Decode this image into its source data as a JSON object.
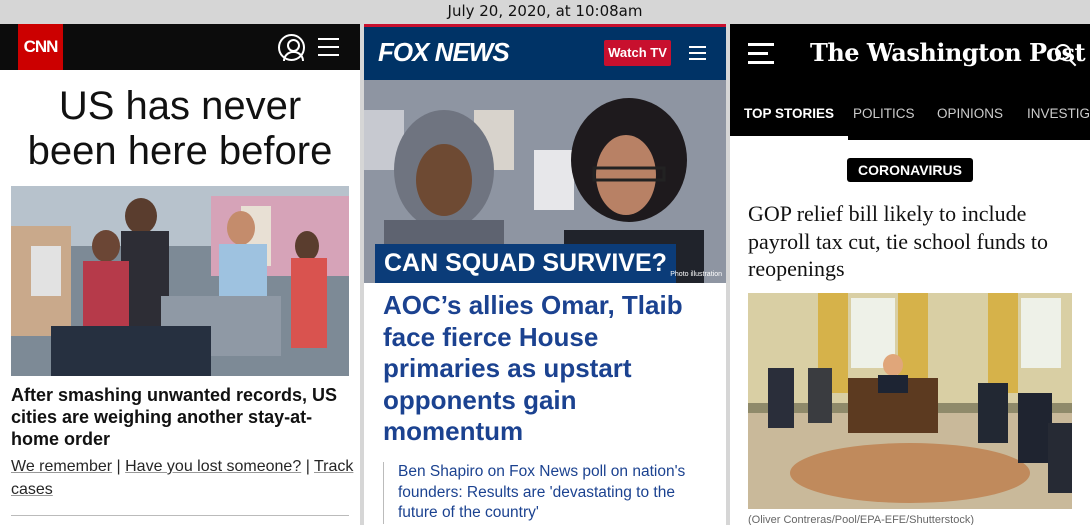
{
  "timestamp": "July 20, 2020, at 10:08am",
  "cnn": {
    "logo": "CNN",
    "headline_line1": "US has never",
    "headline_line2": "been here before",
    "story": "After smashing unwanted records, US cities are weighing another stay-at-home order",
    "link1": "We remember",
    "link2": "Have you lost someone?",
    "link3": "Track cases",
    "separator": "|",
    "icons": {
      "user": "user-account-icon",
      "menu": "hamburger-menu-icon"
    },
    "accent": "#cc0000"
  },
  "fox": {
    "logo": "FOX NEWS",
    "watch_label": "Watch TV",
    "photo_banner": "CAN SQUAD SURVIVE?",
    "photo_credit": "Photo illustration",
    "headline": "AOC’s allies Omar, Tlaib face fierce House primaries as upstart opponents gain momentum",
    "related": "Ben Shapiro on Fox News poll on nation's founders: Results are 'devastating to the future of the country'",
    "icons": {
      "menu": "hamburger-menu-icon"
    },
    "accent": "#003366"
  },
  "wapo": {
    "logo": "The Washington Post",
    "tabs": [
      "TOP STORIES",
      "POLITICS",
      "OPINIONS",
      "INVESTIGA"
    ],
    "kicker": "CORONAVIRUS",
    "headline": "GOP relief bill likely to include payroll tax cut, tie school funds to reopenings",
    "photo_credit": "(Oliver Contreras/Pool/EPA-EFE/Shutterstock)",
    "icons": {
      "menu": "hamburger-menu-icon",
      "search": "search-icon"
    }
  }
}
